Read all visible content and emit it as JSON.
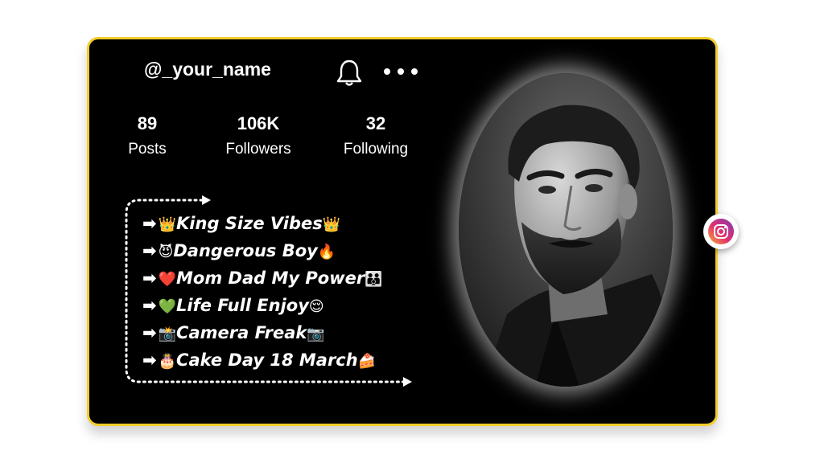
{
  "profile": {
    "username": "@_your_name",
    "stats": [
      {
        "value": "89",
        "label": "Posts"
      },
      {
        "value": "106K",
        "label": "Followers"
      },
      {
        "value": "32",
        "label": "Following"
      }
    ]
  },
  "icons": {
    "bell": "bell-icon",
    "more": "more-dots-icon",
    "instagram": "instagram-icon",
    "portrait": "profile-photo"
  },
  "bio": [
    {
      "arrow": "➡",
      "lead": "👑",
      "text": "King Size Vibes",
      "trail": "👑"
    },
    {
      "arrow": "➡",
      "lead": "😈",
      "text": "Dangerous Boy",
      "trail": "🔥"
    },
    {
      "arrow": "➡",
      "lead": "❤️",
      "text": "Mom Dad My Power",
      "trail": "👪"
    },
    {
      "arrow": "➡",
      "lead": "💚",
      "text": "Life Full Enjoy",
      "trail": "😌"
    },
    {
      "arrow": "➡",
      "lead": "📸",
      "text": "Camera Freak",
      "trail": "📷"
    },
    {
      "arrow": "➡",
      "lead": "🎂",
      "text": "Cake Day 18 March",
      "trail": "🍰"
    }
  ],
  "colors": {
    "card_background": "#000000",
    "card_border": "#f2cc2a",
    "text": "#ffffff"
  }
}
